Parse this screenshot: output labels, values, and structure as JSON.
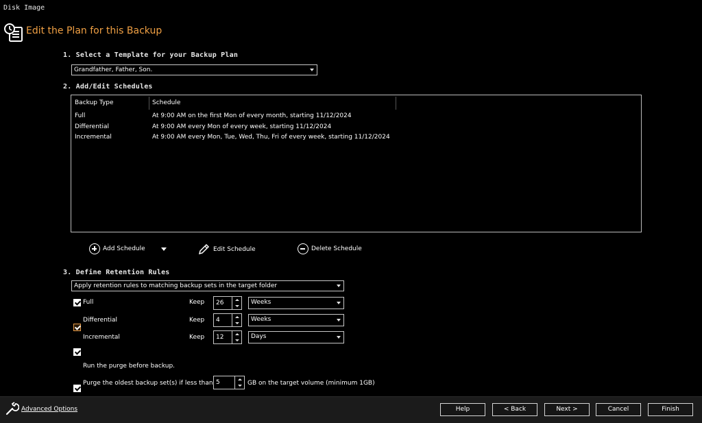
{
  "window": {
    "title": "Disk Image"
  },
  "header": {
    "title": "Edit the Plan for this Backup",
    "icon": "backup-plan-icon"
  },
  "section1": {
    "heading": "1. Select a Template for your Backup Plan",
    "template_value": "Grandfather, Father, Son."
  },
  "section2": {
    "heading": "2. Add/Edit Schedules",
    "columns": [
      "Backup Type",
      "Schedule"
    ],
    "rows": [
      {
        "type": "Full",
        "schedule": "At 9:00 AM on the first Mon of every month, starting 11/12/2024"
      },
      {
        "type": "Differential",
        "schedule": "At 9:00 AM every Mon of every week, starting 11/12/2024"
      },
      {
        "type": "Incremental",
        "schedule": "At 9:00 AM every Mon, Tue, Wed, Thu, Fri of every week, starting 11/12/2024"
      }
    ],
    "actions": {
      "add": "Add Schedule",
      "edit": "Edit Schedule",
      "delete": "Delete Schedule"
    }
  },
  "section3": {
    "heading": "3. Define Retention Rules",
    "rule_mode": "Apply retention rules to matching backup sets in the target folder",
    "keep_label": "Keep",
    "rules": [
      {
        "label": "Full",
        "checked": true,
        "keep": "26",
        "unit": "Weeks"
      },
      {
        "label": "Differential",
        "checked": true,
        "keep": "4",
        "unit": "Weeks"
      },
      {
        "label": "Incremental",
        "checked": true,
        "keep": "12",
        "unit": "Days"
      }
    ],
    "purge_before": {
      "label": "Run the purge before backup.",
      "checked": true
    },
    "purge_oldest": {
      "label": "Purge the oldest backup set(s) if less than",
      "value": "5",
      "suffix": "GB on the target volume (minimum 1GB)",
      "checked": true
    }
  },
  "footer": {
    "advanced": "Advanced Options",
    "buttons": {
      "help": "Help",
      "back": "< Back",
      "next": "Next >",
      "cancel": "Cancel",
      "finish": "Finish"
    }
  },
  "colors": {
    "accent": "#f0a044",
    "background": "#000000",
    "footer": "#1b1b1b"
  }
}
